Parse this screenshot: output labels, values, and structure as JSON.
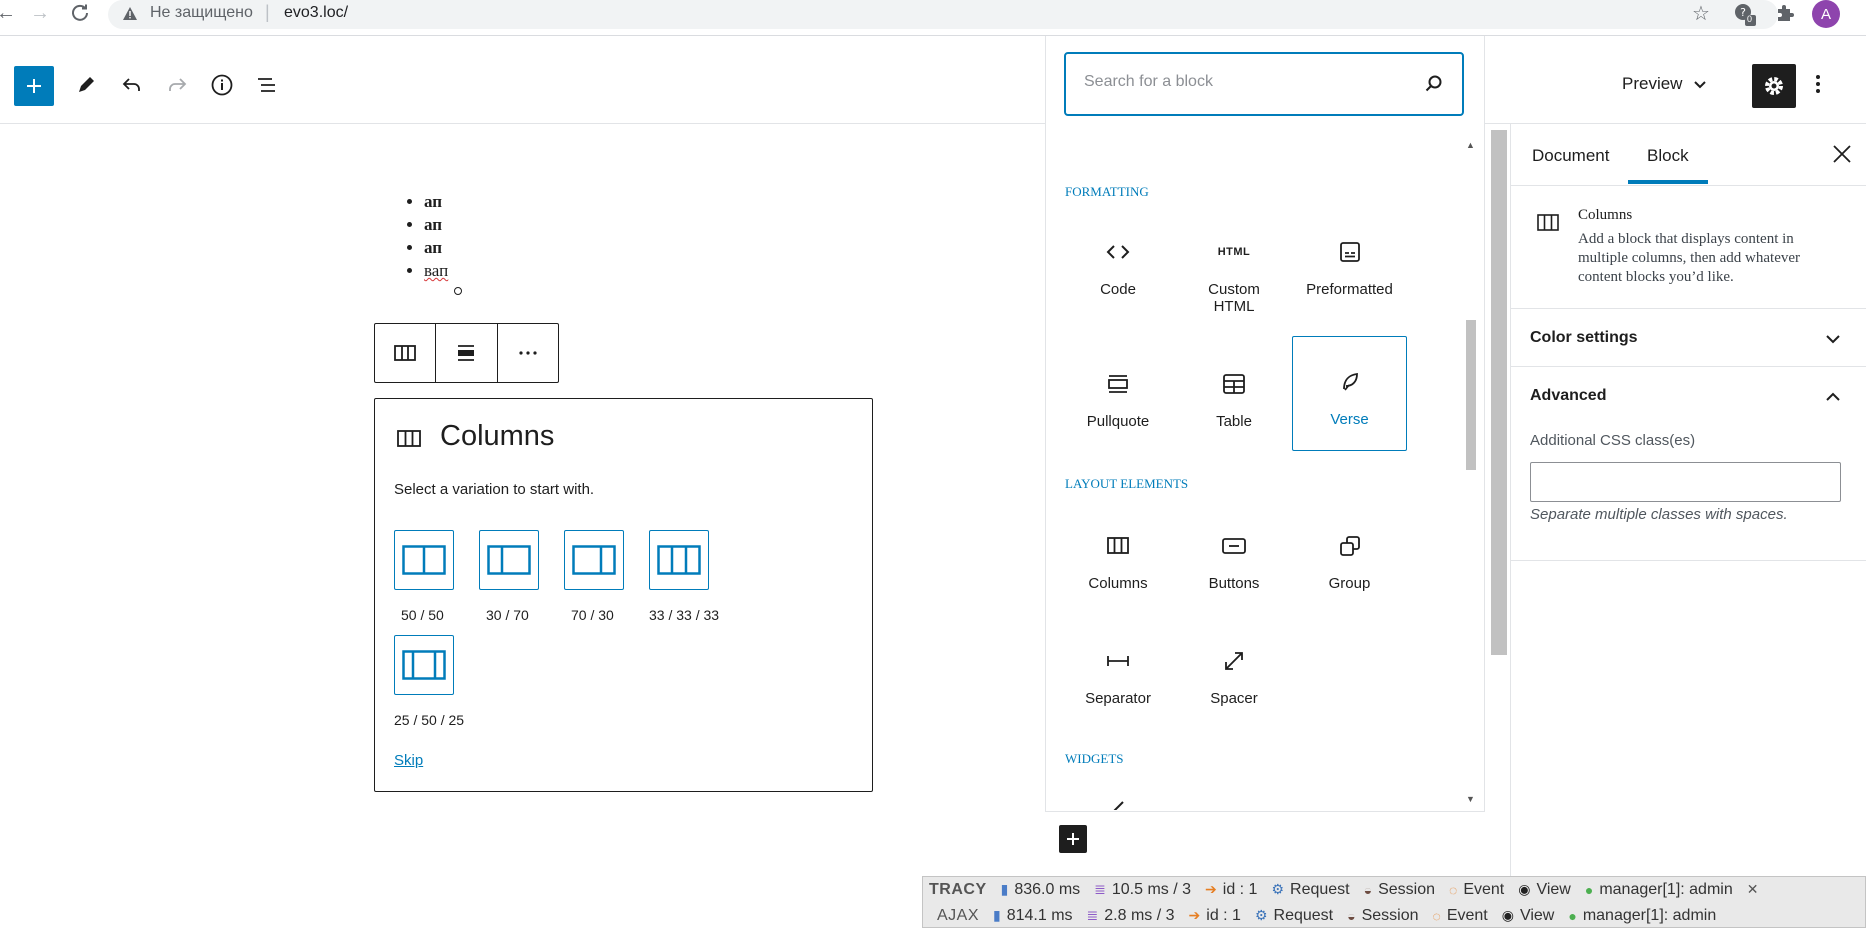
{
  "browser": {
    "security_label": "Не защищено",
    "url": "evo3.loc/",
    "ext_badge": "0",
    "avatar_letter": "A"
  },
  "toolbar": {
    "preview_label": "Preview"
  },
  "content": {
    "list_items": [
      "ап",
      "ап",
      "ап",
      "вап"
    ]
  },
  "columns_placeholder": {
    "title": "Columns",
    "instructions": "Select a variation to start with.",
    "variations": [
      "50 / 50",
      "30 / 70",
      "70 / 30",
      "33 / 33 / 33",
      "25 / 50 / 25"
    ],
    "skip": "Skip"
  },
  "inserter": {
    "search_placeholder": "Search for a block",
    "categories": {
      "formatting": "FORMATTING",
      "layout": "LAYOUT ELEMENTS",
      "widgets": "WIDGETS"
    },
    "formatting_blocks": [
      "Code",
      "Custom HTML",
      "Preformatted",
      "Pullquote",
      "Table",
      "Verse"
    ],
    "layout_blocks": [
      "Columns",
      "Buttons",
      "Group",
      "Separator",
      "Spacer"
    ],
    "html_icon_text": "HTML"
  },
  "sidebar": {
    "tabs": [
      "Document",
      "Block"
    ],
    "active_tab": "Block",
    "block_title": "Columns",
    "block_description": "Add a block that displays content in multiple columns, then add whatever content blocks you’d like.",
    "panels": {
      "color_settings": "Color settings",
      "advanced": "Advanced"
    },
    "css_label": "Additional CSS class(es)",
    "css_help": "Separate multiple classes with spaces."
  },
  "tracy": {
    "row1": {
      "label": "TRACY",
      "time": "836.0 ms",
      "db": "10.5 ms / 3",
      "id": "id : 1",
      "request": "Request",
      "session": "Session",
      "event": "Event",
      "view": "View",
      "user": "manager[1]: admin"
    },
    "row2": {
      "label": "AJAX",
      "time": "814.1 ms",
      "db": "2.8 ms / 3",
      "id": "id : 1",
      "request": "Request",
      "session": "Session",
      "event": "Event",
      "view": "View",
      "user": "manager[1]: admin"
    }
  },
  "colors": {
    "accent": "#007cba",
    "dark": "#1e1e1e"
  }
}
